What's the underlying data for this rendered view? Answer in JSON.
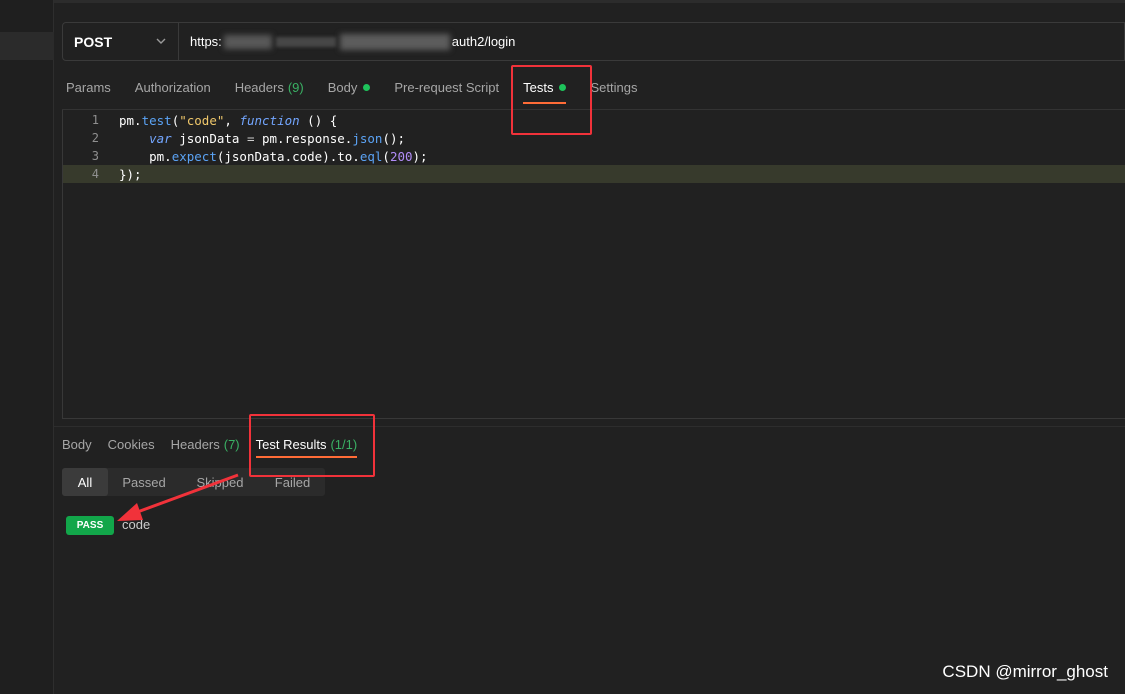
{
  "request": {
    "method": "POST",
    "url_visible_prefix": "https:",
    "url_visible_middle": "...201176:8443/autosec...",
    "url_visible_suffix": "auth2/login"
  },
  "request_tabs": [
    {
      "label": "Params"
    },
    {
      "label": "Authorization"
    },
    {
      "label": "Headers",
      "count": "(9)"
    },
    {
      "label": "Body",
      "dot": true
    },
    {
      "label": "Pre-request Script"
    },
    {
      "label": "Tests",
      "dot": true,
      "active": true
    },
    {
      "label": "Settings"
    }
  ],
  "editor": {
    "lines": [
      {
        "number": "1",
        "text": "pm.test(\"code\", function () {"
      },
      {
        "number": "2",
        "text": "    var jsonData = pm.response.json();"
      },
      {
        "number": "3",
        "text": "    pm.expect(jsonData.code).to.eql(200);"
      },
      {
        "number": "4",
        "text": "});"
      }
    ]
  },
  "response_tabs": [
    {
      "label": "Body"
    },
    {
      "label": "Cookies"
    },
    {
      "label": "Headers",
      "count": "(7)"
    },
    {
      "label": "Test Results",
      "count": "(1/1)",
      "active": true
    }
  ],
  "result_filters": [
    "All",
    "Passed",
    "Skipped",
    "Failed"
  ],
  "results": [
    {
      "status": "PASS",
      "name": "code"
    }
  ],
  "watermark": "CSDN @mirror_ghost",
  "colors": {
    "accent_orange": "#ff6c37",
    "dot_green": "#1ec35b",
    "pass_green": "#12a64a",
    "annotation_red": "#f1323a"
  },
  "icons": {
    "method_dropdown": "chevron-down-icon"
  }
}
